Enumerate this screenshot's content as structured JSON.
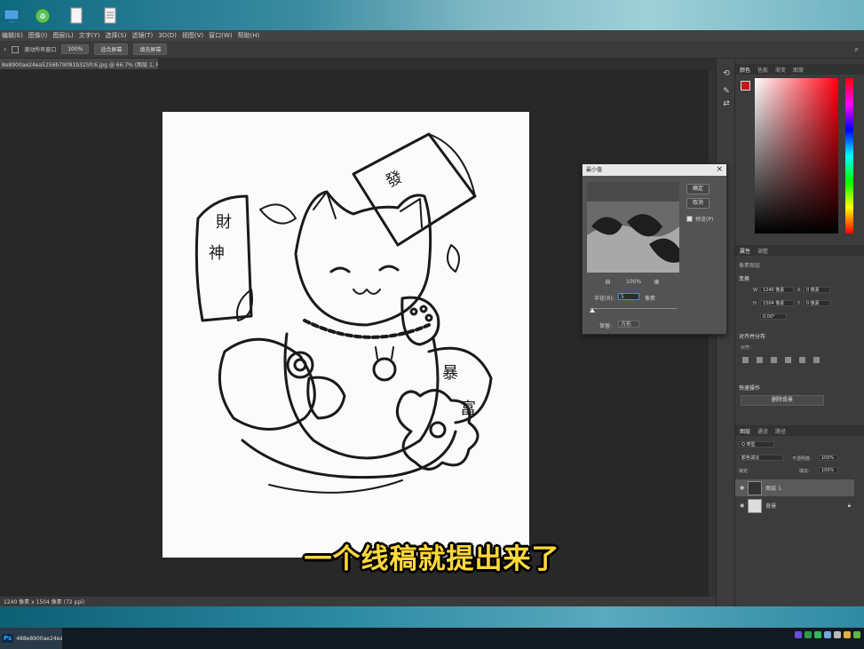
{
  "desktop": {
    "icons": [
      "computer-icon",
      "recycle-bin-icon",
      "document-icon",
      "document-icon"
    ]
  },
  "menubar": {
    "items": [
      "编辑(E)",
      "图像(I)",
      "图层(L)",
      "文字(Y)",
      "选择(S)",
      "滤镜(T)",
      "3D(D)",
      "视图(V)",
      "窗口(W)",
      "帮助(H)"
    ]
  },
  "options": {
    "scroll_all_windows": "滚动所有窗口",
    "zoom_value": "100%",
    "fit_screen": "适合屏幕",
    "fill_screen": "填充屏幕"
  },
  "document": {
    "tab_title": "8e8900ae24ea5256b79081b325fc6.jpg @ 66.7% (图层 1, RGB/8#) *",
    "tab_close": "×",
    "status": "1240 像素 x 1504 像素 (72 ppi)"
  },
  "panels": {
    "color_tabs": [
      "颜色",
      "色板",
      "渐变",
      "图案"
    ],
    "properties_tabs": [
      "属性",
      "调整"
    ],
    "pixel_layer": "像素图层",
    "transform_header": "变换",
    "width_label": "W",
    "width_value": "1240 像素",
    "height_label": "H",
    "height_value": "1504 像素",
    "x_label": "X",
    "x_value": "0 像素",
    "y_label": "Y",
    "y_value": "0 像素",
    "angle_value": "0.00°",
    "align_header": "对齐并分布",
    "align_sub": "对齐:",
    "quick_actions_header": "快速操作",
    "remove_background": "删除背景",
    "layers_tabs": [
      "图层",
      "通道",
      "路径"
    ],
    "kind_filter": "Q 类型",
    "blend_mode": "颜色减淡",
    "opacity_label": "不透明度:",
    "opacity_value": "100%",
    "lock_label": "锁定:",
    "fill_label": "填充:",
    "fill_value": "100%",
    "layers": [
      "图层 1",
      "背景"
    ]
  },
  "dialog": {
    "title": "最小值",
    "close": "×",
    "ok": "确定",
    "cancel": "取消",
    "preview_label": "预览(P)",
    "zoom_value": "100%",
    "radius_label": "半径(R):",
    "radius_value": "5",
    "radius_unit": "像素",
    "preserve_label": "保留:",
    "preserve_value": "方形"
  },
  "taskbar": {
    "app_label": "488e8900ae24ea...",
    "ps_badge": "Ps"
  },
  "subtitle": "一个线稿就提出来了",
  "colors": {
    "subtitle": "#ffd83a",
    "foreground": "#c4161c",
    "background": "#ffffff",
    "accent": "#31a8ff"
  }
}
